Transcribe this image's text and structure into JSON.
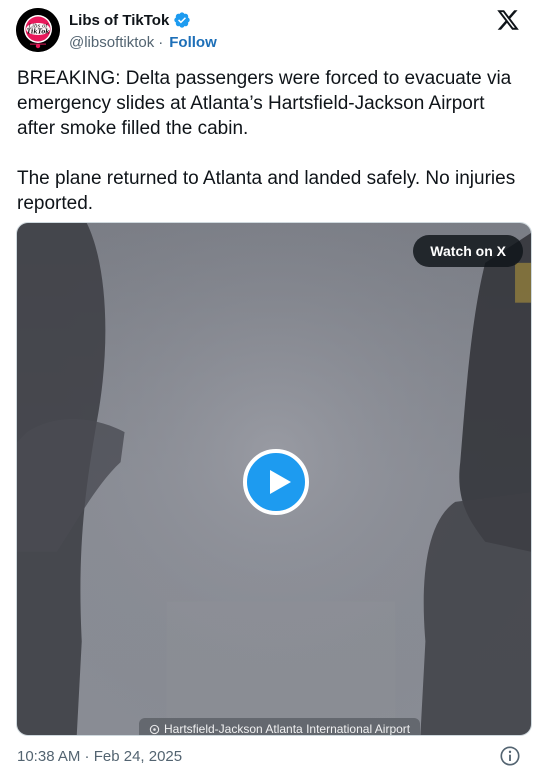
{
  "author": {
    "display_name": "Libs of TikTok",
    "handle": "@libsoftiktok",
    "separator": "·",
    "follow_label": "Follow",
    "avatar_logo_text_1": "Libs of",
    "avatar_logo_text_2": "TikTok",
    "verified_color": "#1d9bf0"
  },
  "tweet": {
    "text": "BREAKING: Delta passengers were forced to evacuate via emergency slides at Atlanta’s Hartsfield-Jackson Airport after smoke filled the cabin.\n\nThe plane returned to Atlanta and landed safely. No injuries reported.",
    "timestamp": "10:38 AM · Feb 24, 2025"
  },
  "media": {
    "watch_label": "Watch on X",
    "location_label": "Hartsfield-Jackson Atlanta International Airport",
    "play_color": "#1d9bf0"
  },
  "icons": {
    "brand": "x-logo-icon",
    "verified": "verified-badge-icon",
    "play": "play-icon",
    "info": "info-icon",
    "location": "location-pin-icon"
  },
  "colors": {
    "link": "#1d6fb8",
    "secondary_text": "#536471",
    "primary_text": "#0f1419"
  }
}
